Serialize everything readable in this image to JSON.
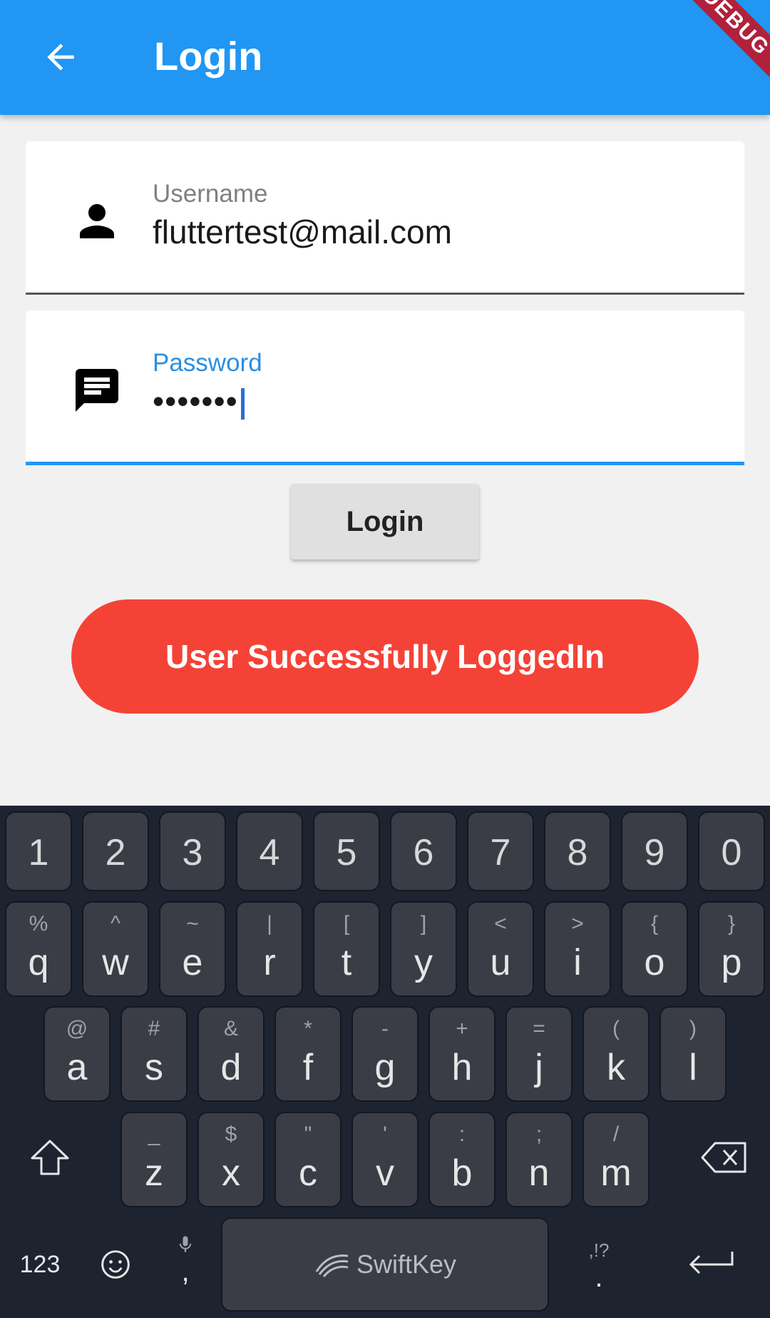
{
  "app": {
    "title": "Login",
    "debug_badge": "DEBUG"
  },
  "form": {
    "username": {
      "label": "Username",
      "value": "fluttertest@mail.com",
      "icon": "person-icon"
    },
    "password": {
      "label": "Password",
      "value": "•••••••",
      "icon": "message-icon"
    },
    "login_button": "Login"
  },
  "banner": {
    "text": "User Successfully LoggedIn",
    "color": "#f44336"
  },
  "keyboard": {
    "number_row": [
      "1",
      "2",
      "3",
      "4",
      "5",
      "6",
      "7",
      "8",
      "9",
      "0"
    ],
    "row1": [
      {
        "m": "q",
        "s": "%"
      },
      {
        "m": "w",
        "s": "^"
      },
      {
        "m": "e",
        "s": "~"
      },
      {
        "m": "r",
        "s": "|"
      },
      {
        "m": "t",
        "s": "["
      },
      {
        "m": "y",
        "s": "]"
      },
      {
        "m": "u",
        "s": "<"
      },
      {
        "m": "i",
        "s": ">"
      },
      {
        "m": "o",
        "s": "{"
      },
      {
        "m": "p",
        "s": "}"
      }
    ],
    "row2": [
      {
        "m": "a",
        "s": "@"
      },
      {
        "m": "s",
        "s": "#"
      },
      {
        "m": "d",
        "s": "&"
      },
      {
        "m": "f",
        "s": "*"
      },
      {
        "m": "g",
        "s": "-"
      },
      {
        "m": "h",
        "s": "+"
      },
      {
        "m": "j",
        "s": "="
      },
      {
        "m": "k",
        "s": "("
      },
      {
        "m": "l",
        "s": ")"
      }
    ],
    "row3": [
      {
        "m": "z",
        "s": "_"
      },
      {
        "m": "x",
        "s": "$"
      },
      {
        "m": "c",
        "s": "\""
      },
      {
        "m": "v",
        "s": "'"
      },
      {
        "m": "b",
        "s": ":"
      },
      {
        "m": "n",
        "s": ";"
      },
      {
        "m": "m",
        "s": "/"
      }
    ],
    "numbers_key": "123",
    "comma_key": ",",
    "period_key": ".",
    "period_secondary": ",!?",
    "space_brand": "SwiftKey"
  }
}
